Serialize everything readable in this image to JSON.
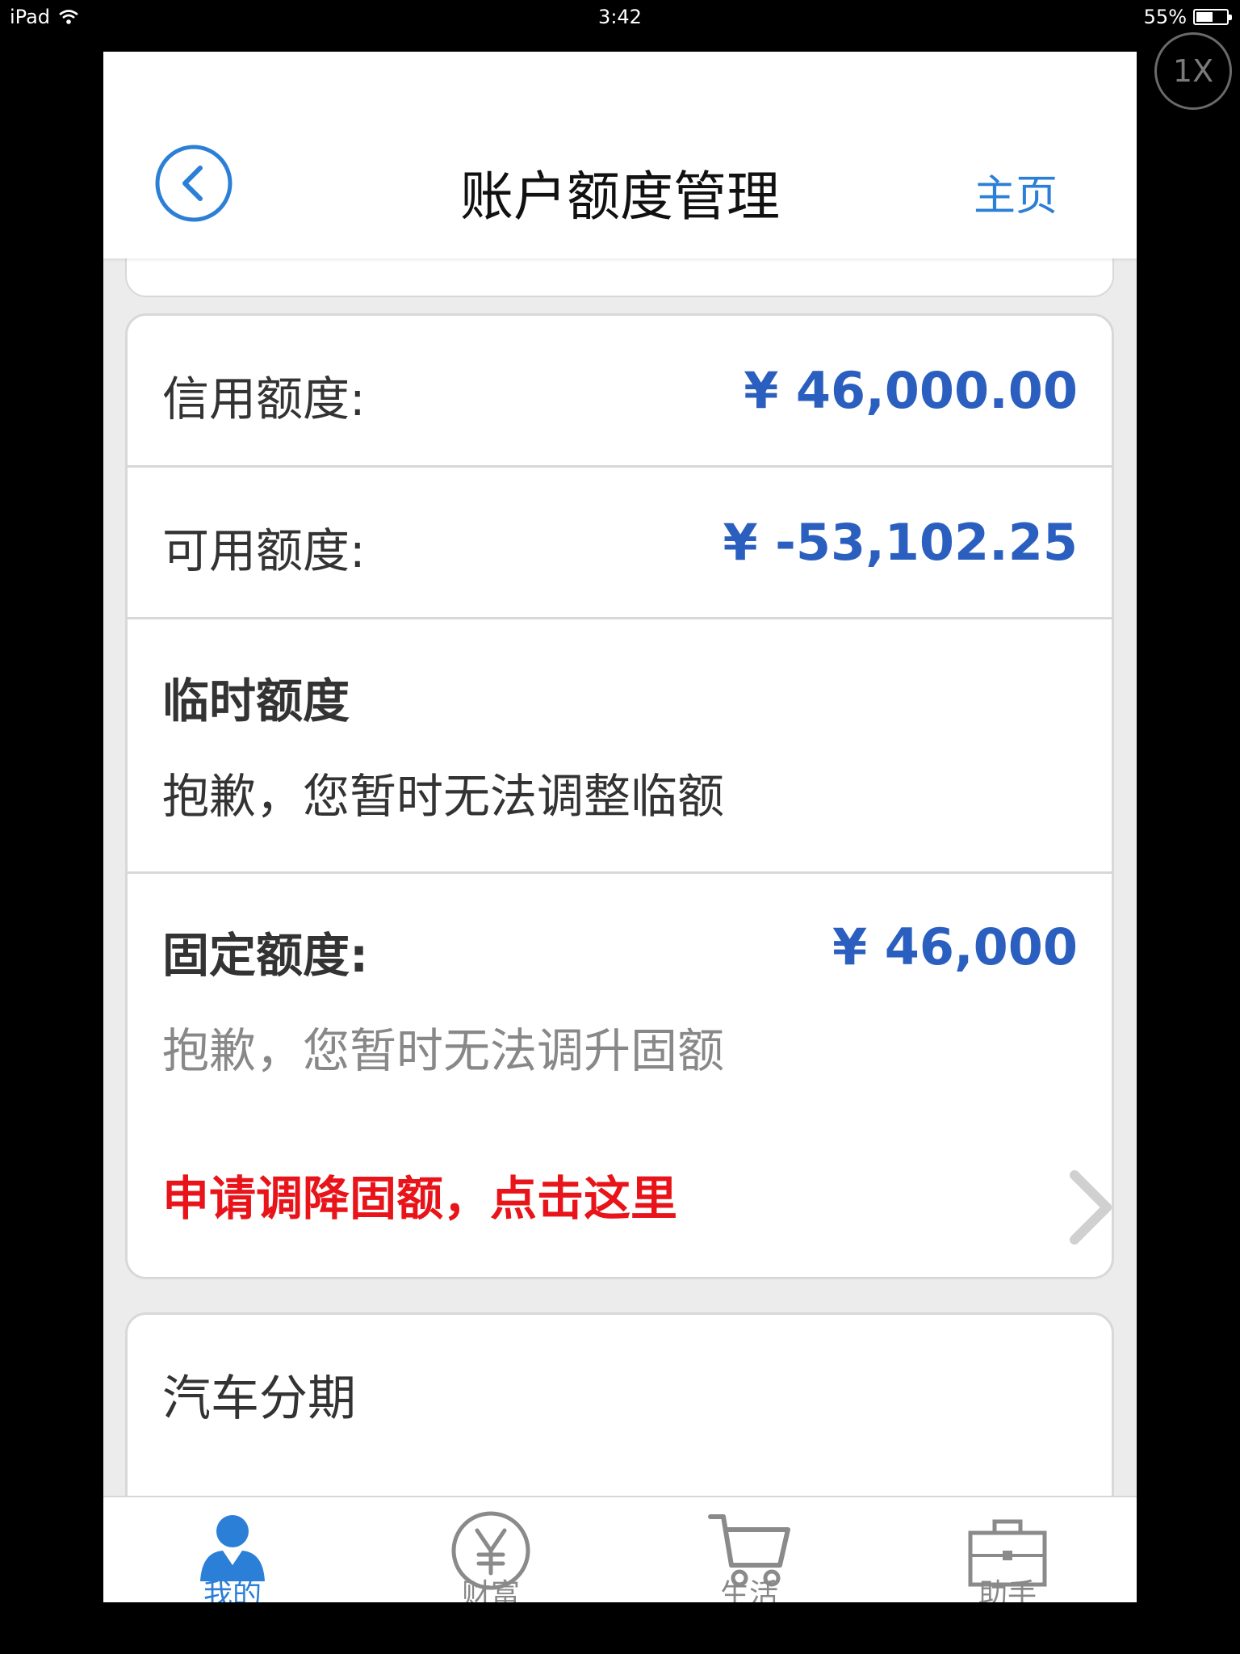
{
  "status_bar": {
    "device": "iPad",
    "time": "3:42",
    "battery": "55%",
    "battery_level": 0.55
  },
  "zoom_badge": "1X",
  "nav": {
    "title": "账户额度管理",
    "home_link": "主页"
  },
  "limits": {
    "credit_label": "信用额度:",
    "credit_value": "¥ 46,000.00",
    "available_label": "可用额度:",
    "available_value": "¥ -53,102.25",
    "temp_title": "临时额度",
    "temp_message": "抱歉，您暂时无法调整临额",
    "fixed_label": "固定额度:",
    "fixed_value": "¥ 46,000",
    "fixed_message": "抱歉，您暂时无法调升固额",
    "decrease_link": "申请调降固额，点击这里"
  },
  "next_section": {
    "title": "汽车分期"
  },
  "tabs": [
    {
      "label": "我的",
      "icon": "user-icon",
      "active": true
    },
    {
      "label": "财富",
      "icon": "yen-icon",
      "active": false
    },
    {
      "label": "生活",
      "icon": "cart-icon",
      "active": false
    },
    {
      "label": "助手",
      "icon": "briefcase-icon",
      "active": false
    }
  ],
  "colors": {
    "accent_blue": "#2b7fd6",
    "amount_blue": "#2b5fbf",
    "link_red": "#e8141a",
    "background": "#ececec"
  }
}
